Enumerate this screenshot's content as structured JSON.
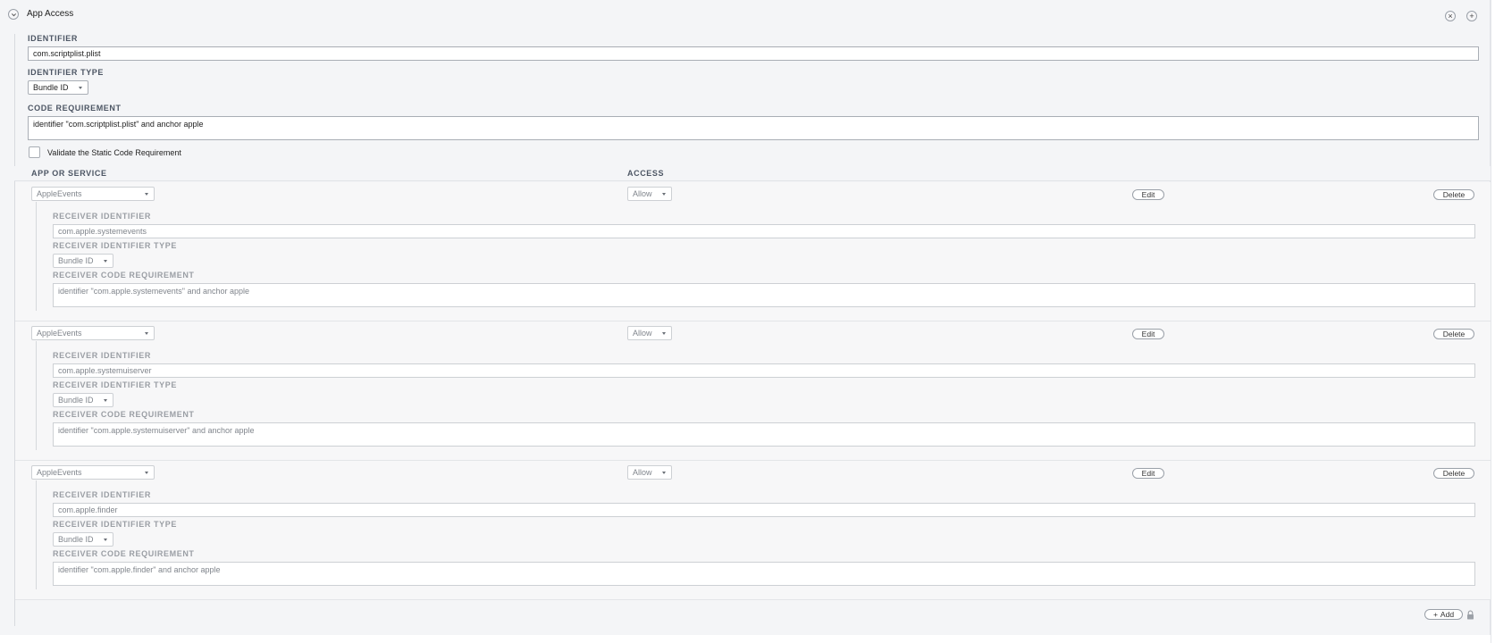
{
  "section": {
    "title": "App Access",
    "identifier_label": "IDENTIFIER",
    "identifier_value": "com.scriptplist.plist",
    "identifier_type_label": "IDENTIFIER TYPE",
    "identifier_type_value": "Bundle ID",
    "code_requirement_label": "CODE REQUIREMENT",
    "code_requirement_value": "identifier \"com.scriptplist.plist\" and anchor apple",
    "validate_label": "Validate the Static Code Requirement"
  },
  "columns": {
    "app_or_service": "APP OR SERVICE",
    "access": "ACCESS"
  },
  "rows": [
    {
      "service": "AppleEvents",
      "access": "Allow",
      "edit": "Edit",
      "delete": "Delete",
      "receiver_identifier_label": "RECEIVER IDENTIFIER",
      "receiver_identifier_value": "com.apple.systemevents",
      "receiver_identifier_type_label": "RECEIVER IDENTIFIER TYPE",
      "receiver_identifier_type_value": "Bundle ID",
      "receiver_code_requirement_label": "RECEIVER CODE REQUIREMENT",
      "receiver_code_requirement_value": "identifier \"com.apple.systemevents\" and anchor apple"
    },
    {
      "service": "AppleEvents",
      "access": "Allow",
      "edit": "Edit",
      "delete": "Delete",
      "receiver_identifier_label": "RECEIVER IDENTIFIER",
      "receiver_identifier_value": "com.apple.systemuiserver",
      "receiver_identifier_type_label": "RECEIVER IDENTIFIER TYPE",
      "receiver_identifier_type_value": "Bundle ID",
      "receiver_code_requirement_label": "RECEIVER CODE REQUIREMENT",
      "receiver_code_requirement_value": "identifier \"com.apple.systemuiserver\" and anchor apple"
    },
    {
      "service": "AppleEvents",
      "access": "Allow",
      "edit": "Edit",
      "delete": "Delete",
      "receiver_identifier_label": "RECEIVER IDENTIFIER",
      "receiver_identifier_value": "com.apple.finder",
      "receiver_identifier_type_label": "RECEIVER IDENTIFIER TYPE",
      "receiver_identifier_type_value": "Bundle ID",
      "receiver_code_requirement_label": "RECEIVER CODE REQUIREMENT",
      "receiver_code_requirement_value": "identifier \"com.apple.finder\" and anchor apple"
    }
  ],
  "footer": {
    "add_label": "Add"
  },
  "icons": {
    "collapse": "chevron-down-icon",
    "remove": "close-icon",
    "add_section": "plus-icon",
    "lock": "lock-icon"
  }
}
